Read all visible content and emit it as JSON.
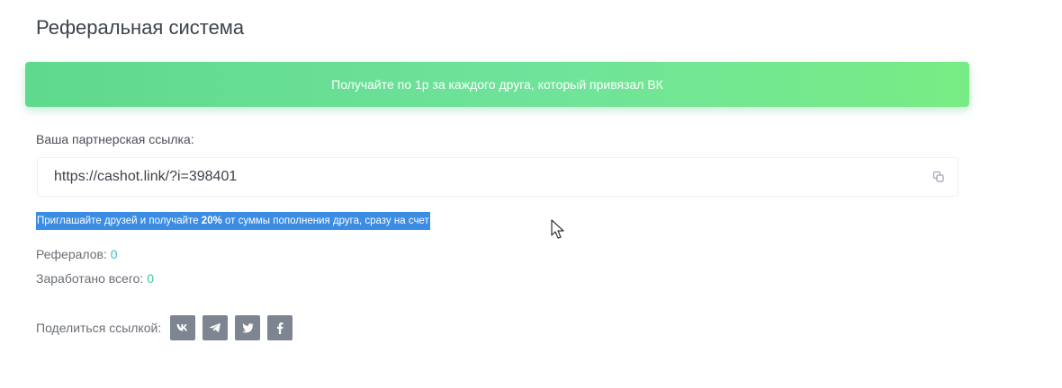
{
  "section": {
    "title": "Реферальная система"
  },
  "banner": {
    "text": "Получайте по 1р за каждого друга, который привязал ВК"
  },
  "partner_link": {
    "label": "Ваша партнерская ссылка:",
    "value": "https://cashot.link/?i=398401",
    "copy_icon": "copy-icon"
  },
  "promo": {
    "before": "Приглашайте друзей и получайте ",
    "percent": "20%",
    "after": " от суммы пополнения друга, сразу на счет"
  },
  "stats": {
    "referrals_label": "Рефералов:",
    "referrals_value": "0",
    "earned_label": "Заработано всего:",
    "earned_value": "0"
  },
  "share": {
    "label": "Поделиться ссылкой:",
    "buttons": [
      {
        "name": "vk",
        "glyph": "vk"
      },
      {
        "name": "telegram",
        "glyph": "telegram-icon"
      },
      {
        "name": "twitter",
        "glyph": "twitter-icon"
      },
      {
        "name": "facebook",
        "glyph": "f"
      }
    ]
  },
  "colors": {
    "banner_gradient_start": "#5fd98e",
    "banner_gradient_end": "#78ec84",
    "selection": "#3b8ce4",
    "stat_value": "#36c3d0",
    "share_button": "#7d8590"
  }
}
